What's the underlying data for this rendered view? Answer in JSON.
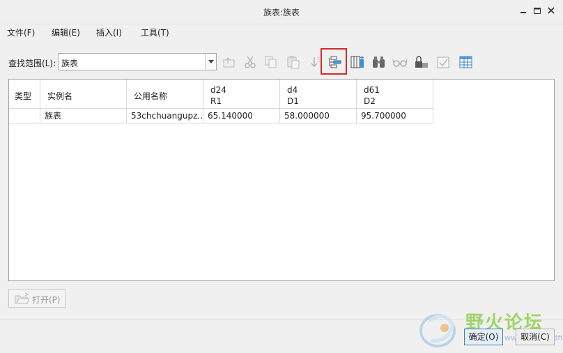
{
  "window": {
    "title": "族表:族表"
  },
  "menu": [
    "文件(F)",
    "编辑(E)",
    "插入(I)",
    "工具(T)"
  ],
  "search": {
    "label": "查找范围(L):",
    "value": "族表"
  },
  "table": {
    "headers": [
      {
        "line1": "类型",
        "line2": ""
      },
      {
        "line1": "实例名",
        "line2": ""
      },
      {
        "line1": "公用名称",
        "line2": ""
      },
      {
        "line1": "d24",
        "line2": "R1"
      },
      {
        "line1": "d4",
        "line2": "D1"
      },
      {
        "line1": "d61",
        "line2": "D2"
      }
    ],
    "rows": [
      [
        "",
        "族表",
        "53chchuangupz...",
        "65.140000",
        "58.000000",
        "95.700000"
      ]
    ]
  },
  "buttons": {
    "open": "打开(P)",
    "ok": "确定(O)",
    "cancel": "取消(C)"
  },
  "watermark": {
    "text": "野火论坛",
    "sub": "www.proewildfire.cn"
  },
  "colors": {
    "highlight": "#d62a2a",
    "ok_border": "#3c7fb1",
    "watermark": "#8fd14f"
  }
}
